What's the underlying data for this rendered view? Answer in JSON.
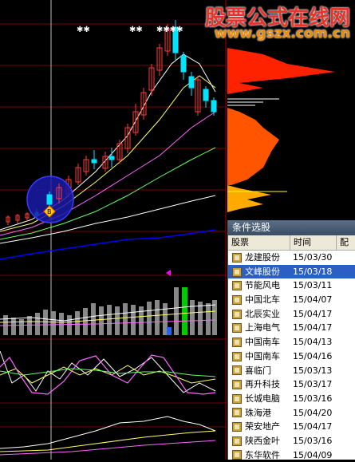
{
  "watermark": {
    "line1": "股票公式在线网",
    "line2": "www.gszx.com.cn"
  },
  "markers": {
    "buy_symbol": "B"
  },
  "colors": {
    "up": "#ff3b3b",
    "down": "#00e5ff",
    "ma5": "#ffffff",
    "ma10": "#ffff66",
    "ma20": "#ff66ff",
    "ma30": "#66ff66",
    "ma60": "#0000ff",
    "circle": "#2222ff"
  },
  "panel": {
    "title": "条件选股",
    "columns": [
      "股票",
      "时间",
      "配"
    ],
    "rows": [
      {
        "name": "龙建股份",
        "date": "15/03/30",
        "selected": false
      },
      {
        "name": "文峰股份",
        "date": "15/03/18",
        "selected": true
      },
      {
        "name": "节能风电",
        "date": "15/03/11",
        "selected": false
      },
      {
        "name": "中国北车",
        "date": "15/04/07",
        "selected": false
      },
      {
        "name": "北辰实业",
        "date": "15/04/17",
        "selected": false
      },
      {
        "name": "上海电气",
        "date": "15/04/17",
        "selected": false
      },
      {
        "name": "中国南车",
        "date": "15/04/13",
        "selected": false
      },
      {
        "name": "中国南车",
        "date": "15/04/16",
        "selected": false
      },
      {
        "name": "喜临门",
        "date": "15/03/13",
        "selected": false
      },
      {
        "name": "再升科技",
        "date": "15/03/17",
        "selected": false
      },
      {
        "name": "长城电脑",
        "date": "15/03/16",
        "selected": false
      },
      {
        "name": "珠海港",
        "date": "15/04/20",
        "selected": false
      },
      {
        "name": "荣安地产",
        "date": "15/04/17",
        "selected": false
      },
      {
        "name": "陕西金叶",
        "date": "15/03/16",
        "selected": false
      },
      {
        "name": "东华软件",
        "date": "15/04/09",
        "selected": false
      }
    ]
  }
}
